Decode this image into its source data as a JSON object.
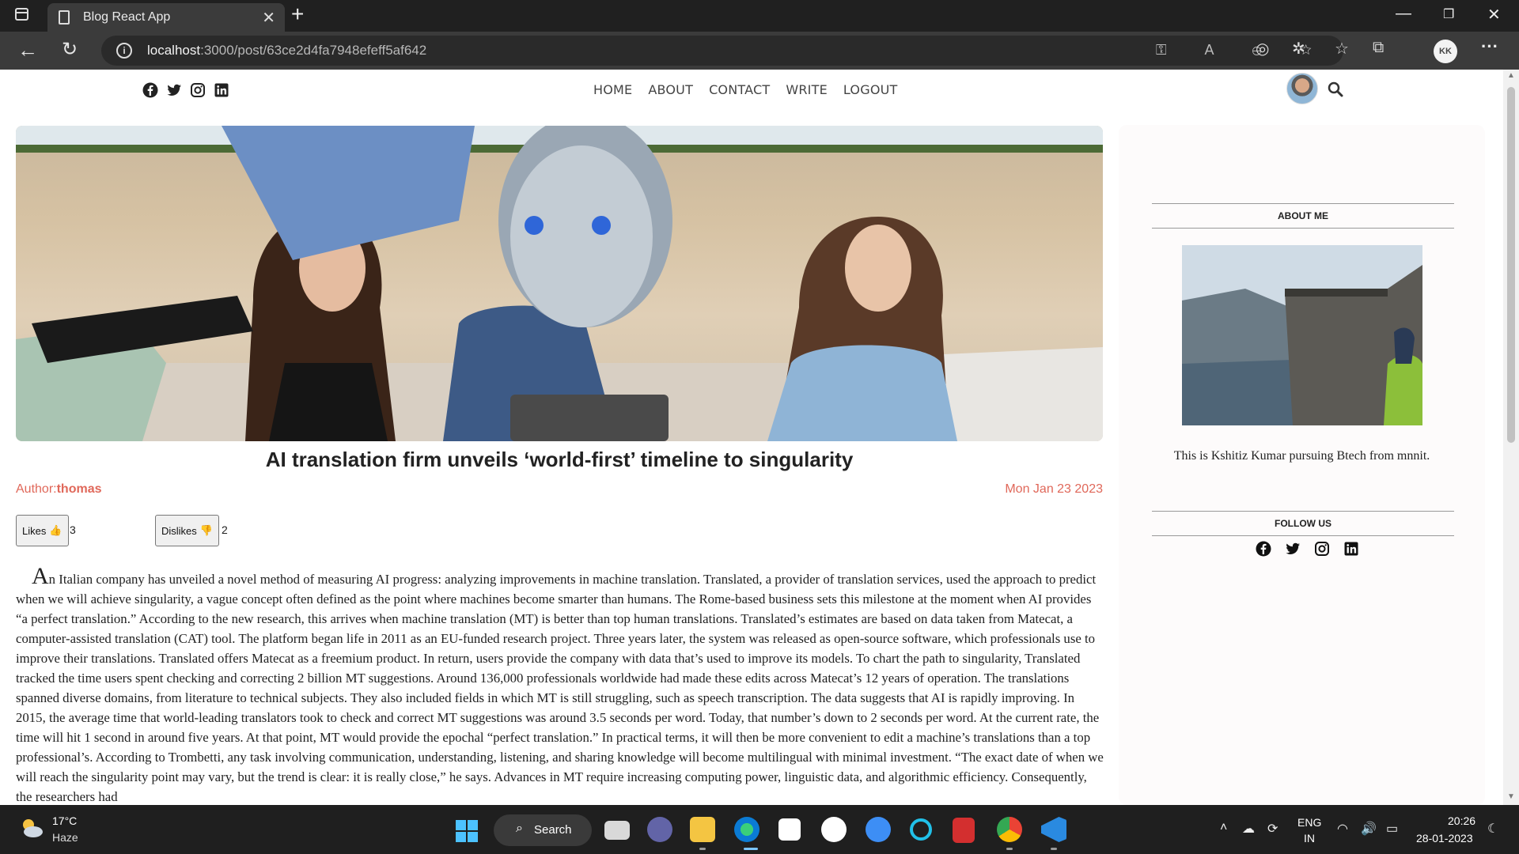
{
  "browser": {
    "tab_title": "Blog React App",
    "url_host": "localhost",
    "url_rest": ":3000/post/63ce2d4fa7948efeff5af642",
    "profile_initials": "KK"
  },
  "site": {
    "nav": [
      "HOME",
      "ABOUT",
      "CONTACT",
      "WRITE",
      "LOGOUT"
    ]
  },
  "post": {
    "title": "AI translation firm unveils ‘world-first’ timeline to singularity",
    "author_label": "Author:",
    "author_name": "thomas",
    "date": "Mon Jan 23 2023",
    "likes_label": "Likes",
    "likes_count": "3",
    "dislikes_label": "Dislikes",
    "dislikes_count": "2",
    "body_first_letter": "A",
    "body_rest": "n Italian company has unveiled a novel method of measuring AI progress: analyzing improvements in machine translation. Translated, a provider of translation services, used the approach to predict when we will achieve singularity, a vague concept often defined as the point where machines become smarter than humans. The Rome-based business sets this milestone at the moment when AI provides “a perfect translation.” According to the new research, this arrives when machine translation (MT) is better than top human translations. Translated’s estimates are based on data taken from Matecat, a computer-assisted translation (CAT) tool. The platform began life in 2011 as an EU-funded research project. Three years later, the system was released as open-source software, which professionals use to improve their translations. Translated offers Matecat as a freemium product. In return, users provide the company with data that’s used to improve its models. To chart the path to singularity, Translated tracked the time users spent checking and correcting 2 billion MT suggestions. Around 136,000 professionals worldwide had made these edits across Matecat’s 12 years of operation. The translations spanned diverse domains, from literature to technical subjects. They also included fields in which MT is still struggling, such as speech transcription. The data suggests that AI is rapidly improving. In 2015, the average time that world-leading translators took to check and correct MT suggestions was around 3.5 seconds per word. Today, that number’s down to 2 seconds per word. At the current rate, the time will hit 1 second in around five years. At that point, MT would provide the epochal “perfect translation.” In practical terms, it will then be more convenient to edit a machine’s translations than a top professional’s. According to Trombetti, any task involving communication, understanding, listening, and sharing knowledge will become multilingual with minimal investment. “The exact date of when we will reach the singularity point may vary, but the trend is clear: it is really close,” he says. Advances in MT require increasing computing power, linguistic data, and algorithmic efficiency. Consequently, the researchers had"
  },
  "sidebar": {
    "about_heading": "ABOUT ME",
    "about_text": "This is Kshitiz Kumar pursuing Btech from mnnit.",
    "follow_heading": "FOLLOW US"
  },
  "taskbar": {
    "temperature": "17°C",
    "weather": "Haze",
    "search_label": "Search",
    "lang": "ENG",
    "region": "IN",
    "time": "20:26",
    "date": "28-01-2023"
  }
}
